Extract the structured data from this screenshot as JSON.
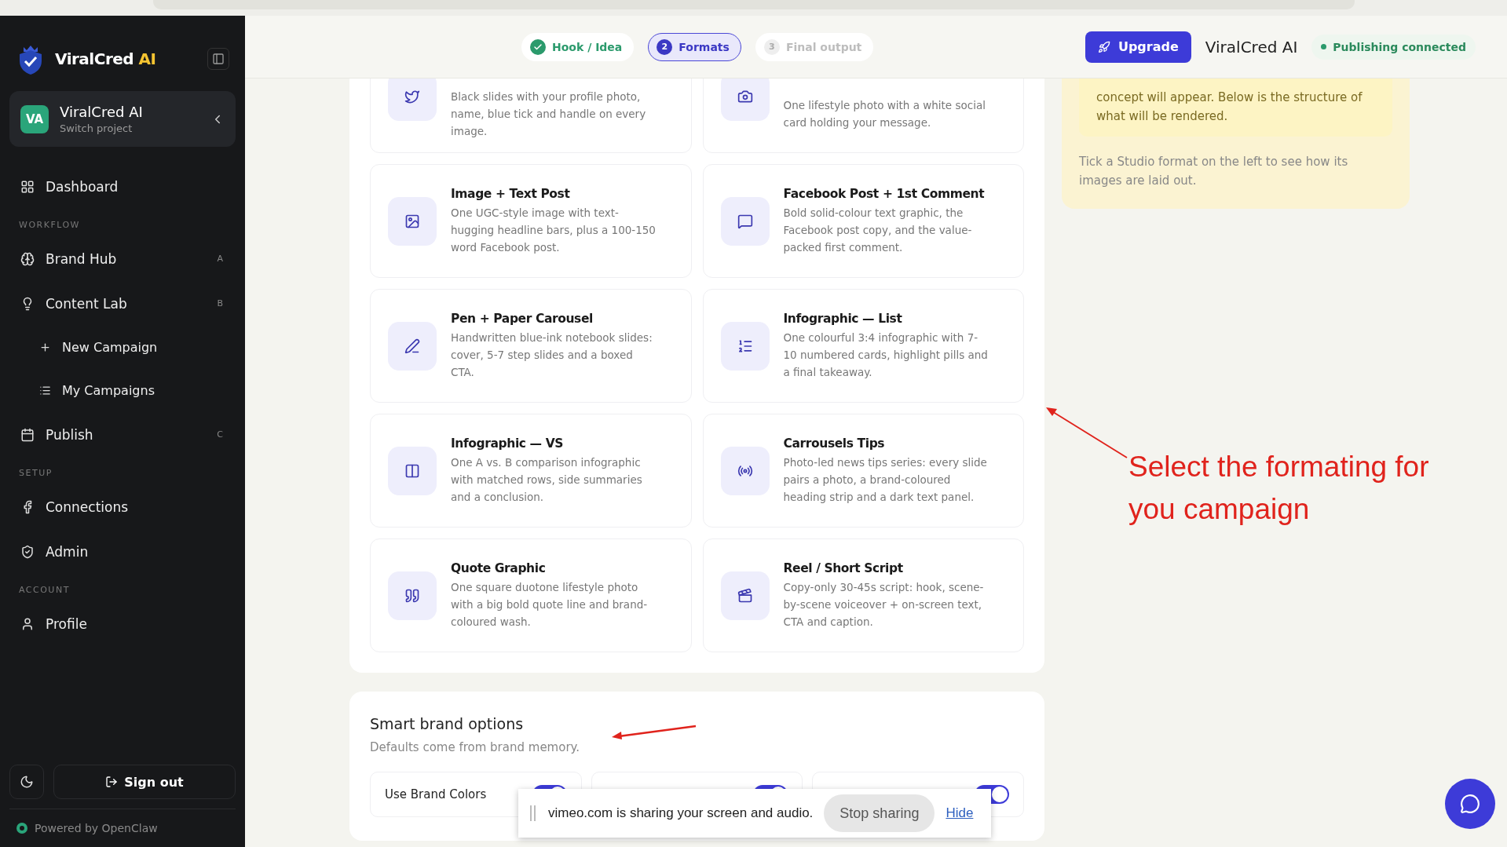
{
  "sidebar": {
    "brand": {
      "name": "ViralCred",
      "accent": "AI"
    },
    "project": {
      "initials": "VA",
      "name": "ViralCred AI",
      "subtitle": "Switch project"
    },
    "items": [
      {
        "kind": "nav",
        "label": "Dashboard"
      },
      {
        "kind": "section",
        "label": "WORKFLOW"
      },
      {
        "kind": "nav",
        "label": "Brand Hub",
        "shortcut": "A"
      },
      {
        "kind": "nav",
        "label": "Content Lab",
        "shortcut": "B"
      },
      {
        "kind": "sub",
        "label": "New Campaign"
      },
      {
        "kind": "sub",
        "label": "My Campaigns"
      },
      {
        "kind": "nav",
        "label": "Publish",
        "shortcut": "C"
      },
      {
        "kind": "section",
        "label": "SETUP"
      },
      {
        "kind": "nav",
        "label": "Connections"
      },
      {
        "kind": "nav",
        "label": "Admin"
      },
      {
        "kind": "section",
        "label": "ACCOUNT"
      },
      {
        "kind": "nav",
        "label": "Profile"
      }
    ],
    "sign_out": "Sign out",
    "footer": "Powered by OpenClaw"
  },
  "header": {
    "steps": [
      {
        "label": "Hook / Idea",
        "completed": true,
        "selected": false
      },
      {
        "label": "Formats",
        "number": "2",
        "completed": false,
        "selected": true
      },
      {
        "label": "Final output",
        "number": "3",
        "completed": false,
        "selected": false
      }
    ],
    "upgrade": "Upgrade",
    "app_name": "ViralCred AI",
    "status": "Publishing connected"
  },
  "formats": [
    {
      "description": "Black slides with your profile photo, name, blue tick and handle on every image."
    },
    {
      "description": "One lifestyle photo with a white social card holding your message."
    },
    {
      "title": "Image + Text Post",
      "description": "One UGC-style image with text-hugging headline bars, plus a 100-150 word Facebook post."
    },
    {
      "title": "Facebook Post + 1st Comment",
      "description": "Bold solid-colour text graphic, the Facebook post copy, and the value-packed first comment."
    },
    {
      "title": "Pen + Paper Carousel",
      "description": "Handwritten blue-ink notebook slides: cover, 5-7 step slides and a boxed CTA."
    },
    {
      "title": "Infographic — List",
      "description": "One colourful 3:4 infographic with 7-10 numbered cards, highlight pills and a final takeaway."
    },
    {
      "title": "Infographic — VS",
      "description": "One A vs. B comparison infographic with matched rows, side summaries and a conclusion."
    },
    {
      "title": "Carrousels Tips",
      "description": "Photo-led news tips series: every slide pairs a photo, a brand-coloured heading strip and a dark text panel."
    },
    {
      "title": "Quote Graphic",
      "description": "One square duotone lifestyle photo with a big bold quote line and brand-coloured wash."
    },
    {
      "title": "Reel / Short Script",
      "description": "Copy-only 30-45s script: hook, scene-by-scene voiceover + on-screen text, CTA and caption."
    }
  ],
  "preview": {
    "notice": "concept will appear. Below is the structure of what will be rendered.",
    "hint": "Tick a Studio format on the left to see how its images are laid out."
  },
  "smart_options": {
    "title": "Smart brand options",
    "subtitle": "Defaults come from brand memory.",
    "toggles": [
      {
        "label": "Use Brand Colors",
        "on": true
      },
      {
        "on": true
      },
      {
        "on": true
      }
    ]
  },
  "share_bar": {
    "message": "vimeo.com is sharing your screen and audio.",
    "stop": "Stop sharing",
    "hide": "Hide"
  },
  "annotation": {
    "text": "Select the formating for you campaign"
  }
}
